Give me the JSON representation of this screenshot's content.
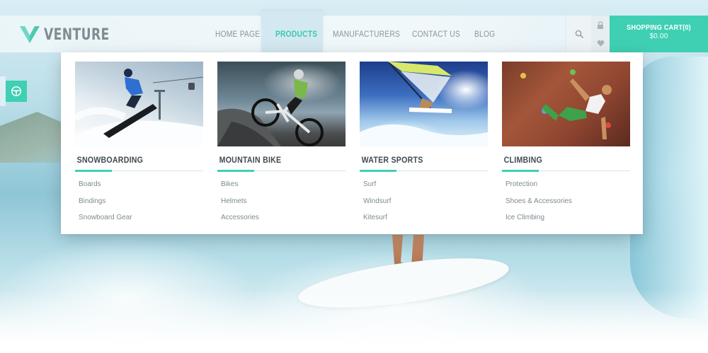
{
  "brand": {
    "name": "VENTURE",
    "accent": "#3fd0b4"
  },
  "nav": {
    "items": [
      {
        "label": "HOME PAGE"
      },
      {
        "label": "PRODUCTS",
        "active": true
      },
      {
        "label": "MANUFACTURERS"
      },
      {
        "label": "CONTACT US"
      },
      {
        "label": "BLOG"
      }
    ]
  },
  "header_icons": [
    "search-icon",
    "lock-icon",
    "heart-icon"
  ],
  "cart": {
    "label": "SHOPPING CART(0)",
    "amount": "$0.00"
  },
  "side_widget": {
    "icon": "steering-wheel-icon"
  },
  "mega_menu": {
    "columns": [
      {
        "title": "SNOWBOARDING",
        "image": "snowboarder-jump-photo",
        "links": [
          "Boards",
          "Bindings",
          "Snowboard Gear"
        ]
      },
      {
        "title": "MOUNTAIN BIKE",
        "image": "mountain-biker-jump-photo",
        "links": [
          "Bikes",
          "Helmets",
          "Accessories"
        ]
      },
      {
        "title": "WATER SPORTS",
        "image": "windsurfer-photo",
        "links": [
          "Surf",
          "Windsurf",
          "Kitesurf"
        ]
      },
      {
        "title": "CLIMBING",
        "image": "rock-climber-wall-photo",
        "links": [
          "Protection",
          "Shoes & Accessories",
          "Ice Climbing"
        ]
      }
    ]
  }
}
